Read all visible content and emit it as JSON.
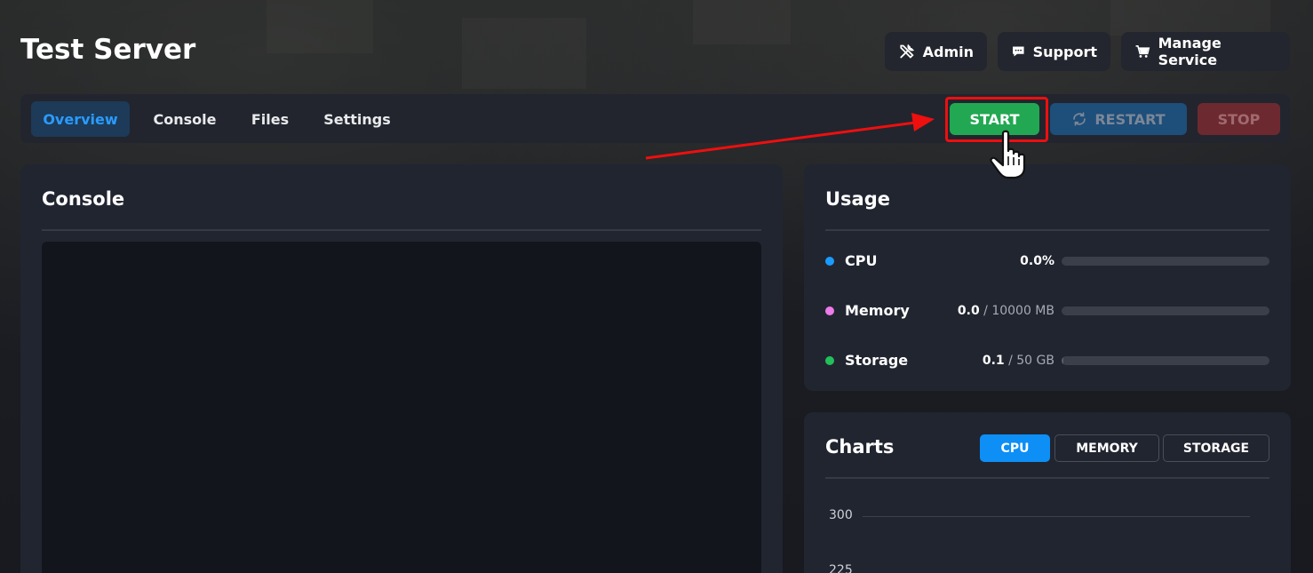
{
  "header": {
    "title": "Test Server"
  },
  "top_buttons": [
    {
      "label": "Admin",
      "icon": "tools-icon"
    },
    {
      "label": "Support",
      "icon": "chat-icon"
    },
    {
      "label": "Manage Service",
      "icon": "cart-icon"
    }
  ],
  "nav": {
    "tabs": [
      {
        "label": "Overview",
        "active": true
      },
      {
        "label": "Console",
        "active": false
      },
      {
        "label": "Files",
        "active": false
      },
      {
        "label": "Settings",
        "active": false
      }
    ]
  },
  "power": {
    "start_label": "START",
    "restart_label": "RESTART",
    "stop_label": "STOP",
    "colors": {
      "start": "#22a852",
      "restart": "#1e4e7a",
      "stop": "#6c2a30"
    }
  },
  "console": {
    "title": "Console"
  },
  "usage": {
    "title": "Usage",
    "rows": [
      {
        "label": "CPU",
        "value": "0.0%",
        "unit": "",
        "color": "#1a9bff",
        "fraction": 0.0
      },
      {
        "label": "Memory",
        "value": "0.0",
        "unit": " / 10000 MB",
        "color": "#ee7bea",
        "fraction": 0.0
      },
      {
        "label": "Storage",
        "value": "0.1",
        "unit": " / 50 GB",
        "color": "#22c05a",
        "fraction": 0.002
      }
    ]
  },
  "charts": {
    "title": "Charts",
    "tabs": [
      {
        "label": "CPU",
        "active": true
      },
      {
        "label": "MEMORY",
        "active": false
      },
      {
        "label": "STORAGE",
        "active": false
      }
    ],
    "y_ticks": [
      "300",
      "225"
    ]
  },
  "annotation": {
    "highlight_color": "#ee0f0f"
  }
}
